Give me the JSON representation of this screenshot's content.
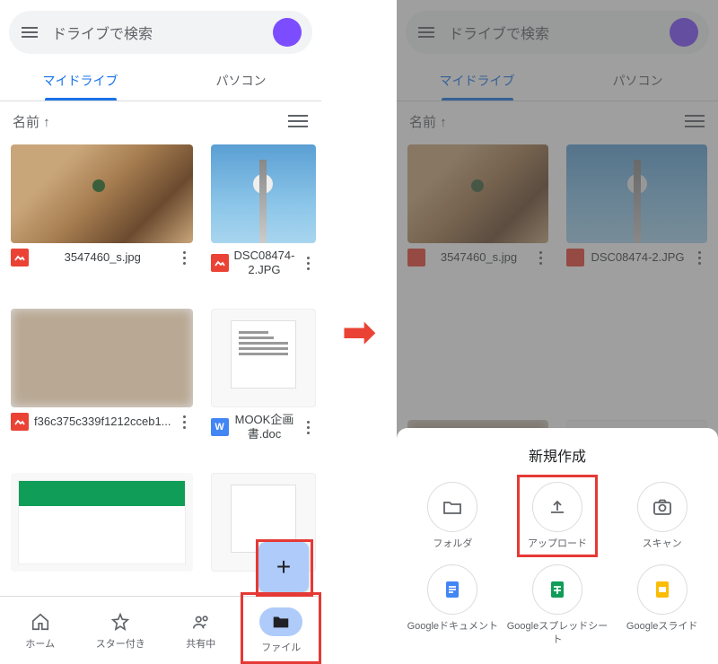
{
  "search_placeholder": "ドライブで検索",
  "tabs": {
    "mydrive": "マイドライブ",
    "pc": "パソコン"
  },
  "sort_label": "名前 ↑",
  "files": [
    {
      "name": "3547460_s.jpg",
      "type": "img"
    },
    {
      "name": "DSC08474-2.JPG",
      "type": "img"
    },
    {
      "name": "f36c375c339f1212cceb1...",
      "type": "img"
    },
    {
      "name": "MOOK企画書.doc",
      "type": "word"
    }
  ],
  "bottom_nav": {
    "home": "ホーム",
    "starred": "スター付き",
    "shared": "共有中",
    "files": "ファイル"
  },
  "sheet": {
    "title": "新規作成",
    "folder": "フォルダ",
    "upload": "アップロード",
    "scan": "スキャン",
    "gdocs": "Googleドキュメント",
    "gsheets": "Googleスプレッドシート",
    "gslides": "Googleスライド"
  }
}
